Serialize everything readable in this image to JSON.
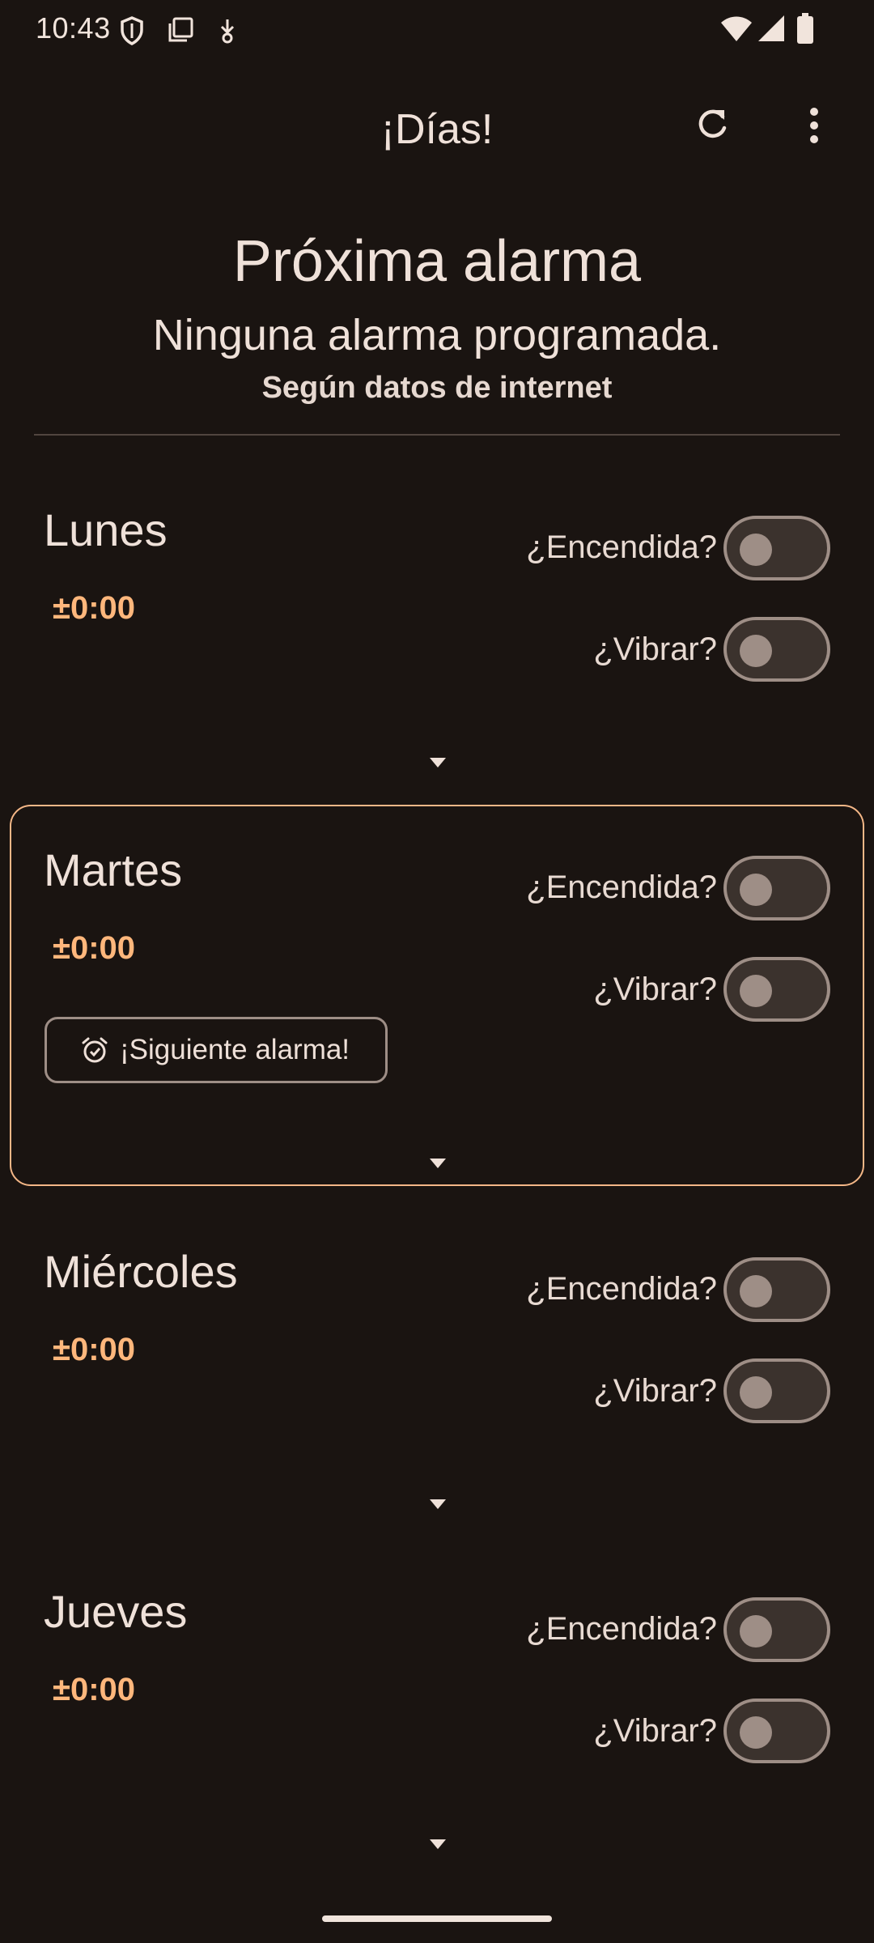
{
  "status_bar": {
    "time": "10:43"
  },
  "app_bar": {
    "title": "¡Días!",
    "refresh_icon": "refresh-icon",
    "more_icon": "more-vert-icon"
  },
  "header": {
    "title": "Próxima alarma",
    "subtitle": "Ninguna alarma programada.",
    "source": "Según datos de internet"
  },
  "days": [
    {
      "name": "Lunes",
      "offset": "±0:00",
      "on_label": "¿Encendida?",
      "vibrate_label": "¿Vibrar?",
      "enabled": false,
      "vibrate": false
    },
    {
      "name": "Martes",
      "offset": "±0:00",
      "on_label": "¿Encendida?",
      "vibrate_label": "¿Vibrar?",
      "enabled": false,
      "vibrate": false,
      "next_alarm_label": "¡Siguiente alarma!"
    },
    {
      "name": "Miércoles",
      "offset": "±0:00",
      "on_label": "¿Encendida?",
      "vibrate_label": "¿Vibrar?",
      "enabled": false,
      "vibrate": false
    },
    {
      "name": "Jueves",
      "offset": "±0:00",
      "on_label": "¿Encendida?",
      "vibrate_label": "¿Vibrar?",
      "enabled": false,
      "vibrate": false
    }
  ],
  "colors": {
    "background": "#1a1411",
    "accent": "#ffb77c",
    "highlight_border": "#f4b787",
    "switch_outline": "#9e8e86"
  }
}
